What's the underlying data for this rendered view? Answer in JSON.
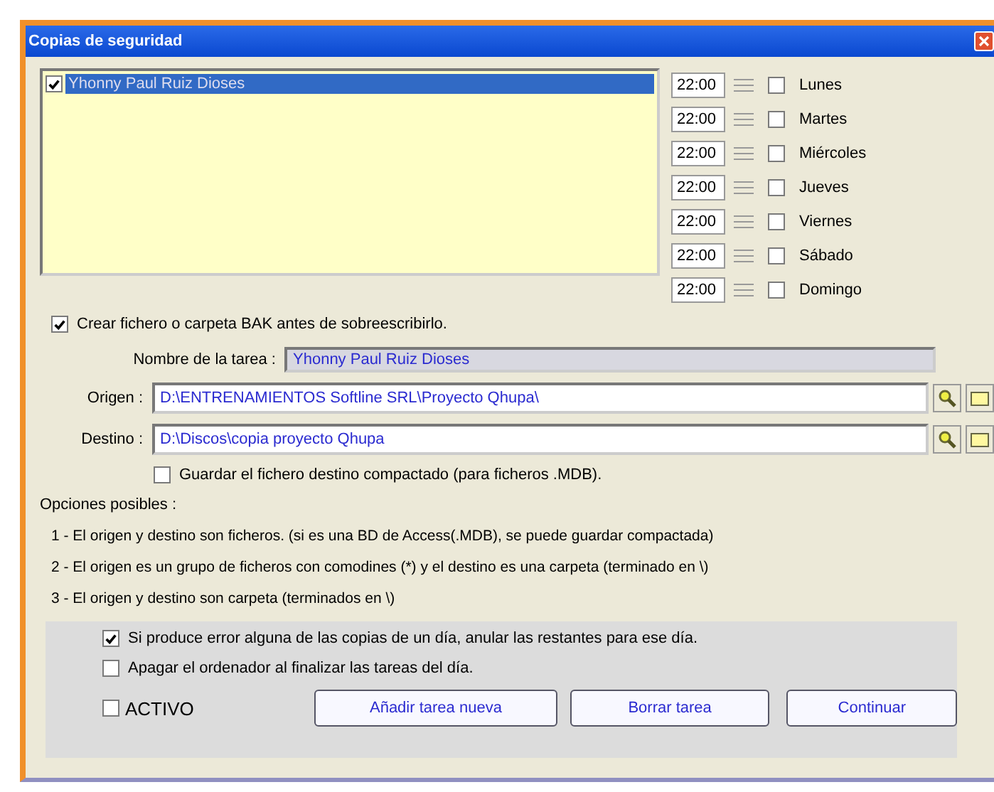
{
  "window": {
    "title": "Copias de seguridad"
  },
  "tasks": [
    {
      "label": "Yhonny Paul Ruiz Dioses",
      "checked": true,
      "selected": true
    }
  ],
  "schedule": [
    {
      "time": "22:00",
      "day": "Lunes",
      "checked": false
    },
    {
      "time": "22:00",
      "day": "Martes",
      "checked": false
    },
    {
      "time": "22:00",
      "day": "Miércoles",
      "checked": false
    },
    {
      "time": "22:00",
      "day": "Jueves",
      "checked": false
    },
    {
      "time": "22:00",
      "day": "Viernes",
      "checked": false
    },
    {
      "time": "22:00",
      "day": "Sábado",
      "checked": false
    },
    {
      "time": "22:00",
      "day": "Domingo",
      "checked": false
    }
  ],
  "bak_option": {
    "label": "Crear fichero o carpeta BAK antes de sobreescribirlo.",
    "checked": true
  },
  "task_name": {
    "label": "Nombre de la tarea :",
    "value": "Yhonny Paul Ruiz Dioses"
  },
  "paths": [
    {
      "label": "Origen :",
      "value": "D:\\ENTRENAMIENTOS Softline SRL\\Proyecto Qhupa\\"
    },
    {
      "label": "Destino :",
      "value": "D:\\Discos\\copia proyecto Qhupa"
    }
  ],
  "compact_option": {
    "label": "Guardar el fichero destino compactado (para ficheros .MDB).",
    "checked": false
  },
  "options_heading": "Opciones posibles :",
  "options": [
    "1 - El origen y destino son ficheros. (si es una BD de Access(.MDB), se puede guardar compactada)",
    "2 - El origen es un grupo de ficheros con comodines (*) y el destino es una carpeta (terminado en \\)",
    "3 - El origen y destino son carpeta (terminados en \\)"
  ],
  "bottom_options": [
    {
      "label": "Si produce error alguna de las copias de un día, anular las restantes para ese día.",
      "checked": true
    },
    {
      "label": "Apagar el ordenador al finalizar las tareas del día.",
      "checked": false
    }
  ],
  "active": {
    "label": "ACTIVO",
    "checked": false
  },
  "buttons": [
    "Añadir tarea nueva",
    "Borrar tarea",
    "Continuar"
  ]
}
